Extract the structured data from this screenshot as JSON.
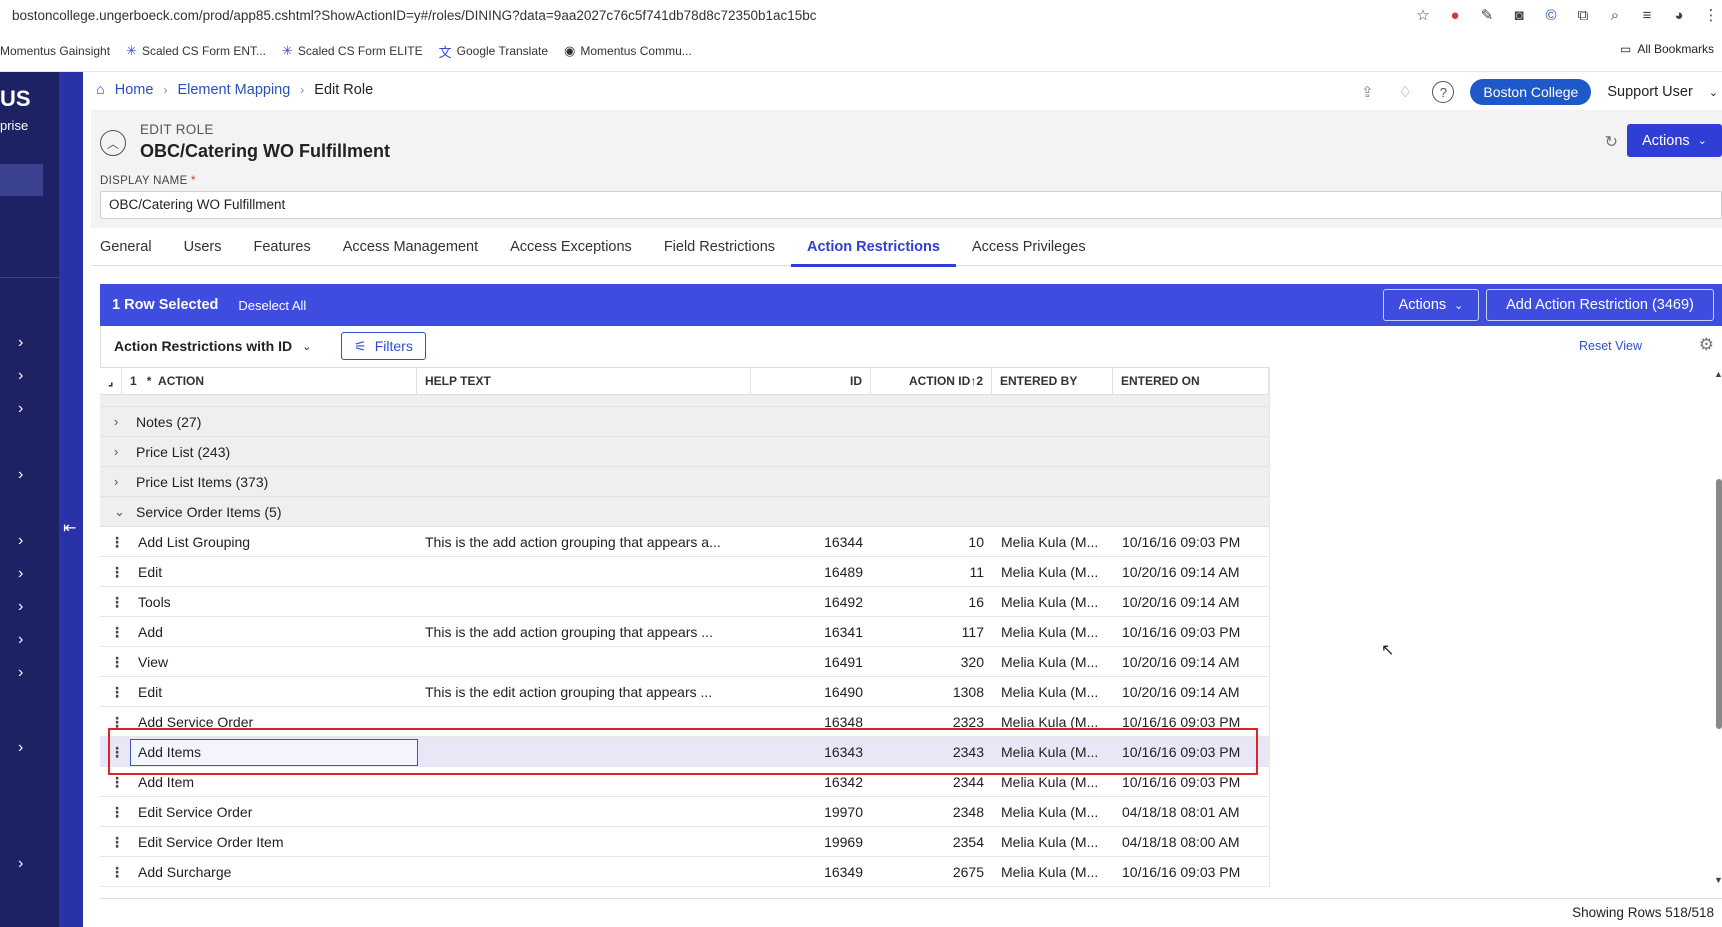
{
  "browser": {
    "url": "bostoncollege.ungerboeck.com/prod/app85.cshtml?ShowActionID=y#/roles/DINING?data=9aa2027c76c5f741db78d8c72350b1ac15bc",
    "bookmarks": [
      {
        "label": "Momentus Gainsight",
        "icon": "folder-icon"
      },
      {
        "label": "Scaled CS Form ENT...",
        "icon": "asterisk-icon"
      },
      {
        "label": "Scaled CS Form ELITE",
        "icon": "asterisk-icon"
      },
      {
        "label": "Google Translate",
        "icon": "translate-icon"
      },
      {
        "label": "Momentus Commu...",
        "icon": "globe-icon"
      }
    ],
    "all_bookmarks": "All Bookmarks"
  },
  "leftnav": {
    "brand": "US",
    "brand_sub": "prise"
  },
  "breadcrumb": {
    "home": "Home",
    "element_mapping": "Element Mapping",
    "current": "Edit Role"
  },
  "header": {
    "org": "Boston College",
    "user": "Support User"
  },
  "role": {
    "eyebrow": "EDIT ROLE",
    "title": "OBC/Catering WO Fulfillment",
    "actions_label": "Actions",
    "display_name_label": "DISPLAY NAME",
    "required_mark": "*",
    "display_name_value": "OBC/Catering WO Fulfillment"
  },
  "tabs": [
    "General",
    "Users",
    "Features",
    "Access Management",
    "Access Exceptions",
    "Field Restrictions",
    "Action Restrictions",
    "Access Privileges"
  ],
  "active_tab": "Action Restrictions",
  "grid": {
    "selected_count": "1 Row Selected",
    "deselect_all": "Deselect All",
    "actions_label": "Actions",
    "add_label": "Add Action Restriction (3469)",
    "view_label": "Action Restrictions with ID",
    "filters_label": "Filters",
    "reset_view": "Reset View",
    "headers": {
      "sort_index": "1",
      "action": "ACTION",
      "help_text": "HELP TEXT",
      "id": "ID",
      "action_id": "ACTION ID",
      "action_id_sort": "2",
      "entered_by": "ENTERED BY",
      "entered_on": "ENTERED ON"
    },
    "groups": [
      "Notes (27)",
      "Price List (243)",
      "Price List Items (373)",
      "Service Order Items (5)"
    ],
    "rows": [
      {
        "action": "Add List Grouping",
        "help": "This is the add action grouping that appears a...",
        "id": "16344",
        "action_id": "10",
        "by": "Melia Kula (M...",
        "on": "10/16/16 09:03 PM"
      },
      {
        "action": "Edit",
        "help": "",
        "id": "16489",
        "action_id": "11",
        "by": "Melia Kula (M...",
        "on": "10/20/16 09:14 AM"
      },
      {
        "action": "Tools",
        "help": "",
        "id": "16492",
        "action_id": "16",
        "by": "Melia Kula (M...",
        "on": "10/20/16 09:14 AM"
      },
      {
        "action": "Add",
        "help": "This is the add action grouping that appears ...",
        "id": "16341",
        "action_id": "117",
        "by": "Melia Kula (M...",
        "on": "10/16/16 09:03 PM"
      },
      {
        "action": "View",
        "help": "",
        "id": "16491",
        "action_id": "320",
        "by": "Melia Kula (M...",
        "on": "10/20/16 09:14 AM"
      },
      {
        "action": "Edit",
        "help": "This is the edit action grouping that appears ...",
        "id": "16490",
        "action_id": "1308",
        "by": "Melia Kula (M...",
        "on": "10/20/16 09:14 AM"
      },
      {
        "action": "Add Service Order",
        "help": "",
        "id": "16348",
        "action_id": "2323",
        "by": "Melia Kula (M...",
        "on": "10/16/16 09:03 PM"
      },
      {
        "action": "Add Items",
        "help": "",
        "id": "16343",
        "action_id": "2343",
        "by": "Melia Kula (M...",
        "on": "10/16/16 09:03 PM"
      },
      {
        "action": "Add Item",
        "help": "",
        "id": "16342",
        "action_id": "2344",
        "by": "Melia Kula (M...",
        "on": "10/16/16 09:03 PM"
      },
      {
        "action": "Edit Service Order",
        "help": "",
        "id": "19970",
        "action_id": "2348",
        "by": "Melia Kula (M...",
        "on": "04/18/18 08:01 AM"
      },
      {
        "action": "Edit Service Order Item",
        "help": "",
        "id": "19969",
        "action_id": "2354",
        "by": "Melia Kula (M...",
        "on": "04/18/18 08:00 AM"
      },
      {
        "action": "Add Surcharge",
        "help": "",
        "id": "16349",
        "action_id": "2675",
        "by": "Melia Kula (M...",
        "on": "10/16/16 09:03 PM"
      }
    ],
    "footer": "Showing Rows 518/518"
  },
  "colors": {
    "nav": "#1c2264",
    "accent": "#3e4de0",
    "link": "#2a4fbf",
    "highlight": "#e0202a"
  }
}
